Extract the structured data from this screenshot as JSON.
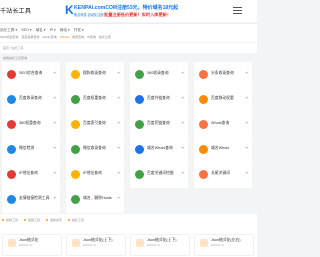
{
  "header": {
    "logo_text": "千站长工具",
    "ad": {
      "brand_mark": "K",
      "brand_name": "KENPAI.com",
      "brand_sub": "焦点科技 自动化注册",
      "line1": ".COM注册53元，特价域名18元起",
      "line2": "批量注册低价更新！实时入库更新！"
    }
  },
  "nav": {
    "items": [
      "站长工具",
      "SEO",
      "域名",
      "IP",
      "网站",
      "开发"
    ],
    "hot": [
      "SEO综合查询",
      "百度权重查询",
      "Whois查询",
      "Chinaz",
      "收录查询",
      "IP查询",
      "站长之家"
    ]
  },
  "breadcrumb": "首页 / 站长工具",
  "section_label": "常用站长工具查询",
  "tools": [
    [
      "SEO综合查询",
      "搜狗收录查询",
      "360收录查询",
      "头条收录查询"
    ],
    [
      "百度收录查询",
      "百度权重查询",
      "百度外链查询",
      "百度移动权重"
    ],
    [
      "360权重查询",
      "百度索引查询",
      "百度死链查询",
      "Whois查询"
    ],
    [
      "微信检测",
      "微信收录查询",
      "域名Whois查询",
      "域名Whois"
    ],
    [
      "IP地址查询",
      "IP地址查询",
      "百度关键词挖掘",
      "长尾关键词"
    ],
    [
      "友情链接检测工具",
      "域名、删除Hosts",
      "",
      ""
    ]
  ],
  "footer": {
    "tabs": [
      "最新工具",
      "最热工具",
      "最新资讯",
      "站长工具"
    ],
    "cards": [
      {
        "title": "Json格式化",
        "meta": "2023.01.01"
      },
      {
        "title": "Json格式化(上下)",
        "meta": "2023.01.01"
      },
      {
        "title": "Json格式化(上下)",
        "meta": "2023.01.01"
      },
      {
        "title": "Json格式化(左右)",
        "meta": "2023.01.01"
      }
    ]
  },
  "colors": {
    "accent": "#1a73e8",
    "warn": "#e53935",
    "hot": "#ff7a00"
  }
}
